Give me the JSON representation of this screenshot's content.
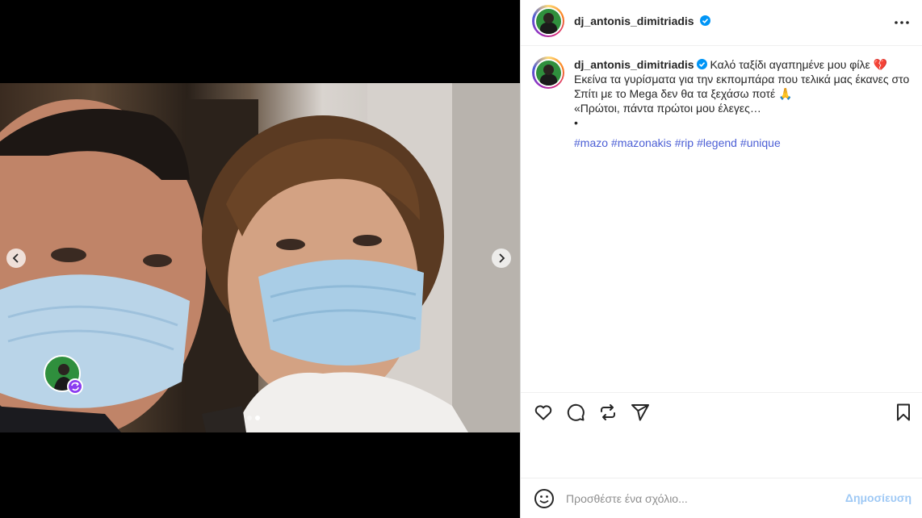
{
  "post": {
    "username": "dj_antonis_dimitriadis",
    "verified": true,
    "caption_lines": [
      "Καλό ταξίδι αγαπημένε μου φίλε 💔",
      "Εκείνα τα γυρίσματα για την εκπομπάρα που τελικά μας έκανες στο Σπίτι με το Mega δεν θα τα ξεχάσω ποτέ 🙏",
      "«Πρώτοι, πάντα πρώτοι μου έλεγες…",
      "•"
    ],
    "hashtags": [
      "#mazo",
      "#mazonakis",
      "#rip",
      "#legend",
      "#unique"
    ]
  },
  "media": {
    "slide_count": 2,
    "active_slide": 2
  },
  "comment": {
    "placeholder": "Προσθέστε ένα σχόλιο...",
    "post_label": "Δημοσίευση"
  },
  "icons": {
    "like": "heart-icon",
    "comment": "comment-icon",
    "repost": "repost-icon",
    "share": "send-icon",
    "save": "bookmark-icon",
    "more": "more-icon",
    "emoji": "emoji-icon",
    "verified": "verified-badge-icon"
  },
  "colors": {
    "verified": "#0095f6",
    "hashtag": "#4c5fd5",
    "post_button_disabled": "#9fc9f5"
  }
}
